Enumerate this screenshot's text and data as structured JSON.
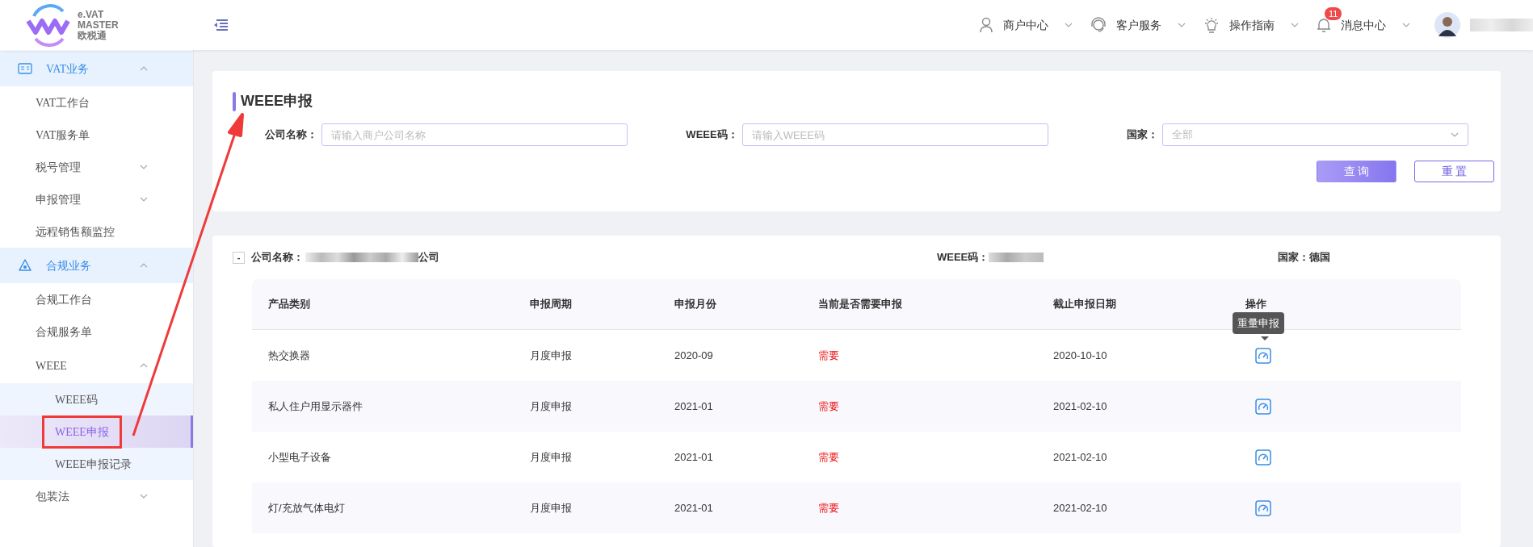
{
  "logo": {
    "line1": "e.VAT",
    "line2": "MASTER",
    "line3": "欧税通"
  },
  "header_menus": [
    {
      "label": "商户中心"
    },
    {
      "label": "客户服务"
    },
    {
      "label": "操作指南"
    },
    {
      "label": "消息中心",
      "badge": "11"
    }
  ],
  "sidebar": [
    {
      "label": "VAT业务",
      "expanded": true,
      "children": [
        {
          "label": "VAT工作台"
        },
        {
          "label": "VAT服务单"
        },
        {
          "label": "税号管理",
          "expanded": false
        },
        {
          "label": "申报管理",
          "expanded": false
        },
        {
          "label": "远程销售额监控"
        }
      ]
    },
    {
      "label": "合规业务",
      "expanded": true,
      "children": [
        {
          "label": "合规工作台"
        },
        {
          "label": "合规服务单"
        },
        {
          "label": "WEEE",
          "expanded": true,
          "children": [
            {
              "label": "WEEE码",
              "selected": false,
              "annotated": false
            },
            {
              "label": "WEEE申报",
              "selected": true,
              "annotated": true
            },
            {
              "label": "WEEE申报记录",
              "selected": false,
              "annotated": false
            }
          ]
        },
        {
          "label": "包装法",
          "expanded": false
        }
      ]
    }
  ],
  "page_title": "WEEE申报",
  "filters": [
    {
      "kind": "input",
      "label": "公司名称：",
      "placeholder": "请输入商户公司名称"
    },
    {
      "kind": "input",
      "label": "WEEE码：",
      "placeholder": "请输入WEEE码"
    },
    {
      "kind": "select",
      "label": "国家：",
      "placeholder": "全部"
    }
  ],
  "buttons": [
    {
      "kind": "primary",
      "label": "查 询"
    },
    {
      "kind": "outline",
      "label": "重 置"
    }
  ],
  "group": {
    "toggle": "-",
    "company_label": "公司名称：",
    "company_suffix": "公司",
    "code_label": "WEEE码：",
    "country": "国家：德国",
    "expanded": true
  },
  "table": {
    "columns": [
      "产品类别",
      "申报周期",
      "申报月份",
      "当前是否需要申报",
      "截止申报日期",
      "操作"
    ],
    "rows": [
      {
        "cells": [
          "热交换器",
          "月度申报",
          "2020-09",
          "需要",
          "2020-10-10"
        ],
        "tooltip": "重量申报"
      },
      {
        "cells": [
          "私人住户用显示器件",
          "月度申报",
          "2021-01",
          "需要",
          "2021-02-10"
        ]
      },
      {
        "cells": [
          "小型电子设备",
          "月度申报",
          "2021-01",
          "需要",
          "2021-02-10"
        ]
      },
      {
        "cells": [
          "灯/充放气体电灯",
          "月度申报",
          "2021-01",
          "需要",
          "2021-02-10"
        ]
      }
    ]
  }
}
